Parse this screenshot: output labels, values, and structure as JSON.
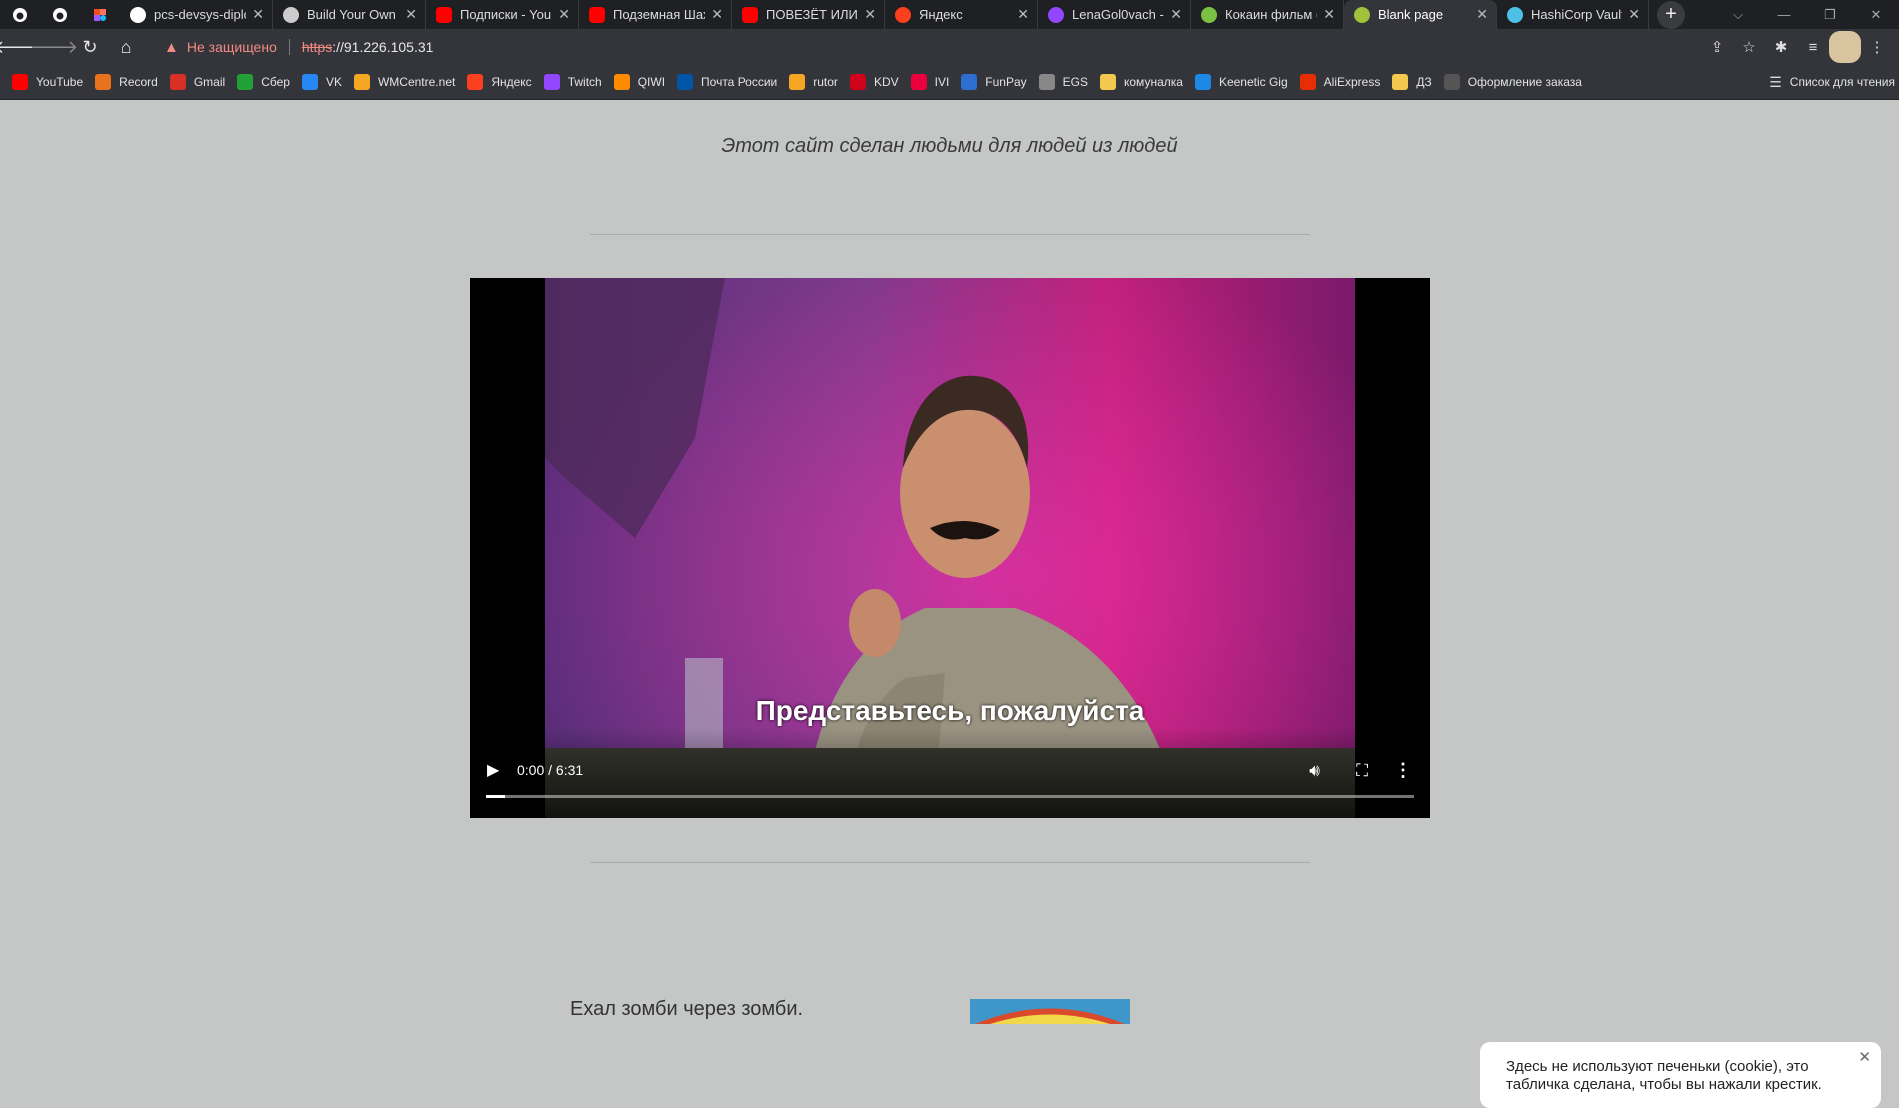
{
  "tabs": [
    {
      "title": "pcs-devsys-diplo",
      "icon": "github-icon"
    },
    {
      "title": "Build Your Own (",
      "icon": "build-icon"
    },
    {
      "title": "Подписки - You",
      "icon": "youtube-icon"
    },
    {
      "title": "Подземная Шах",
      "icon": "youtube-icon"
    },
    {
      "title": "ПОВЕЗЁТ ИЛИ Н",
      "icon": "youtube-icon"
    },
    {
      "title": "Яндекс",
      "icon": "yandex-icon"
    },
    {
      "title": "LenaGol0vach -",
      "icon": "twitch-icon"
    },
    {
      "title": "Кокаин фильм (",
      "icon": "hd-icon"
    },
    {
      "title": "Blank page",
      "icon": "android-icon",
      "active": true
    },
    {
      "title": "HashiCorp Vault",
      "icon": "vault-icon"
    }
  ],
  "address": {
    "security_label": "Не защищено",
    "scheme": "https",
    "rest": "://91.226.105.31"
  },
  "bookmarks": [
    {
      "label": "YouTube",
      "color": "#ff0000"
    },
    {
      "label": "Record",
      "color": "#e8731c"
    },
    {
      "label": "Gmail",
      "color": "#d93025"
    },
    {
      "label": "Сбер",
      "color": "#21a038"
    },
    {
      "label": "VK",
      "color": "#2787f5"
    },
    {
      "label": "WMCentre.net",
      "color": "#f5a623"
    },
    {
      "label": "Яндекс",
      "color": "#fc3f1d"
    },
    {
      "label": "Twitch",
      "color": "#9146ff"
    },
    {
      "label": "QIWI",
      "color": "#ff8c00"
    },
    {
      "label": "Почта России",
      "color": "#0055a6"
    },
    {
      "label": "rutor",
      "color": "#f5a623"
    },
    {
      "label": "KDV",
      "color": "#d0021b"
    },
    {
      "label": "IVI",
      "color": "#ea003d"
    },
    {
      "label": "FunPay",
      "color": "#2d6fd1"
    },
    {
      "label": "EGS",
      "color": "#888888"
    },
    {
      "label": "комуналка",
      "color": "#f2c94c"
    },
    {
      "label": "Keenetic Gig",
      "color": "#1e88e5"
    },
    {
      "label": "AliExpress",
      "color": "#e62e04"
    },
    {
      "label": "ДЗ",
      "color": "#f2c94c"
    },
    {
      "label": "Оформление заказа",
      "color": "#555555"
    }
  ],
  "reading_list": "Список для чтения",
  "page": {
    "tagline": "Этот сайт сделан людьми для людей из людей",
    "video": {
      "subtitle": "Представьтесь, пожалуйста",
      "time": "0:00 / 6:31",
      "progress": 0.02
    },
    "below_text": "Ехал зомби через зомби.",
    "cookie_text": "Здесь не используют печеньки (cookie), это табличка сделана, чтобы вы нажали крестик."
  }
}
